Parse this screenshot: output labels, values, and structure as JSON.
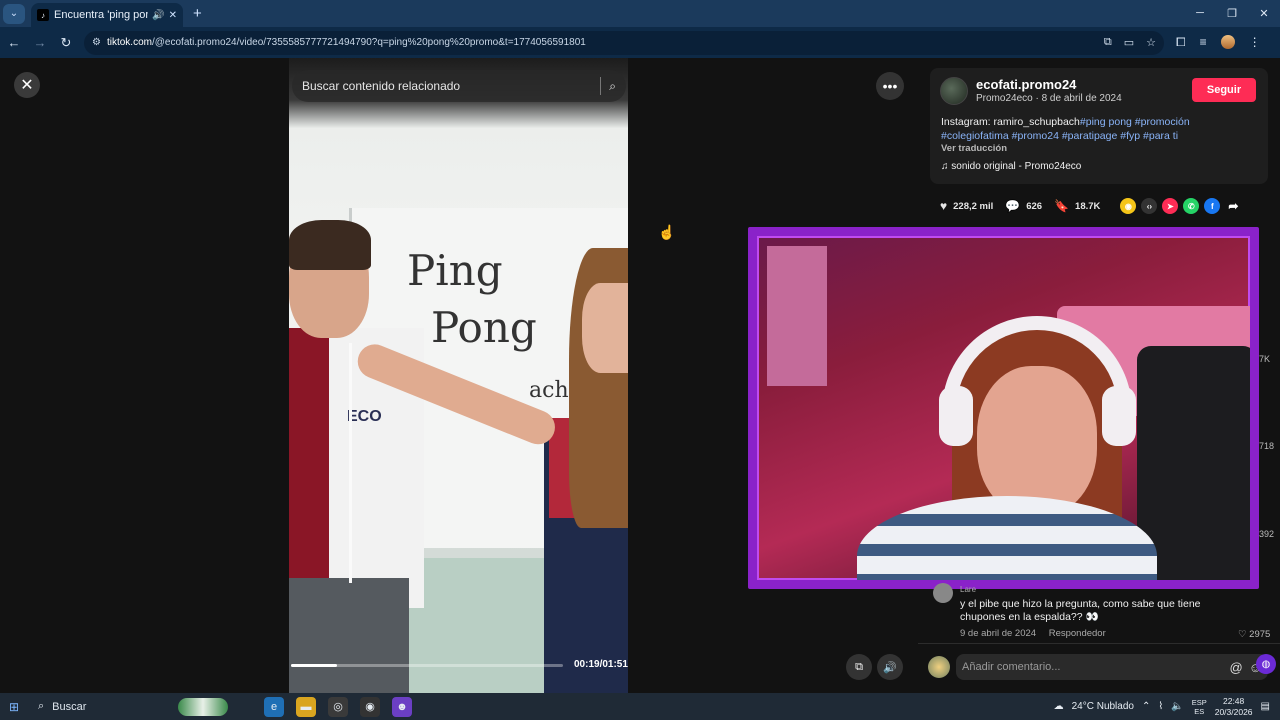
{
  "browser": {
    "tab_title": "Encuentra 'ping pong prom",
    "url_host": "tiktok.com",
    "url_path": "/@ecofati.promo24/video/7355585777721494790?q=ping%20pong%20promo&t=1774056591801"
  },
  "page": {
    "search_placeholder": "Buscar contenido relacionado",
    "video_time": "00:19/01:51",
    "video_progress": 0.17,
    "board_words": [
      "Ping",
      "Pong",
      "ach"
    ],
    "shirt_logo": "ECO"
  },
  "post": {
    "username": "ecofati.promo24",
    "sub": "Promo24eco · 8 de abril de 2024",
    "follow_label": "Seguir",
    "desc_prefix": "Instagram: ramiro_schupbach",
    "hashtags": [
      "#ping pong",
      "#promoción",
      "#colegiofatima",
      "#promo24",
      "#paratipage",
      "#fyp",
      "#para ti"
    ],
    "see_translation": "Ver traducción",
    "sound": "sonido original - Promo24eco"
  },
  "actions": {
    "likes": "228,2 mil",
    "comments": "626",
    "saves": "18.7K"
  },
  "side_counts": [
    "7K",
    "718",
    "392"
  ],
  "comment": {
    "user": "Lare",
    "text": "y el pibe que hizo la pregunta, como sabe que tiene chupones en la espalda?? 👀",
    "date": "9 de abril de 2024",
    "reply_label": "Respondedor",
    "likes": "2975"
  },
  "composer": {
    "placeholder": "Añadir comentario..."
  },
  "taskbar": {
    "search_label": "Buscar",
    "weather": "24°C  Nublado",
    "lang_1": "ESP",
    "lang_2": "ES",
    "time": "22:48",
    "date": "20/3/2026"
  },
  "colors": {
    "follow_red": "#fe2c55",
    "hashtag_blue": "#8ab4f8",
    "webcam_border": "#8a22c9"
  }
}
